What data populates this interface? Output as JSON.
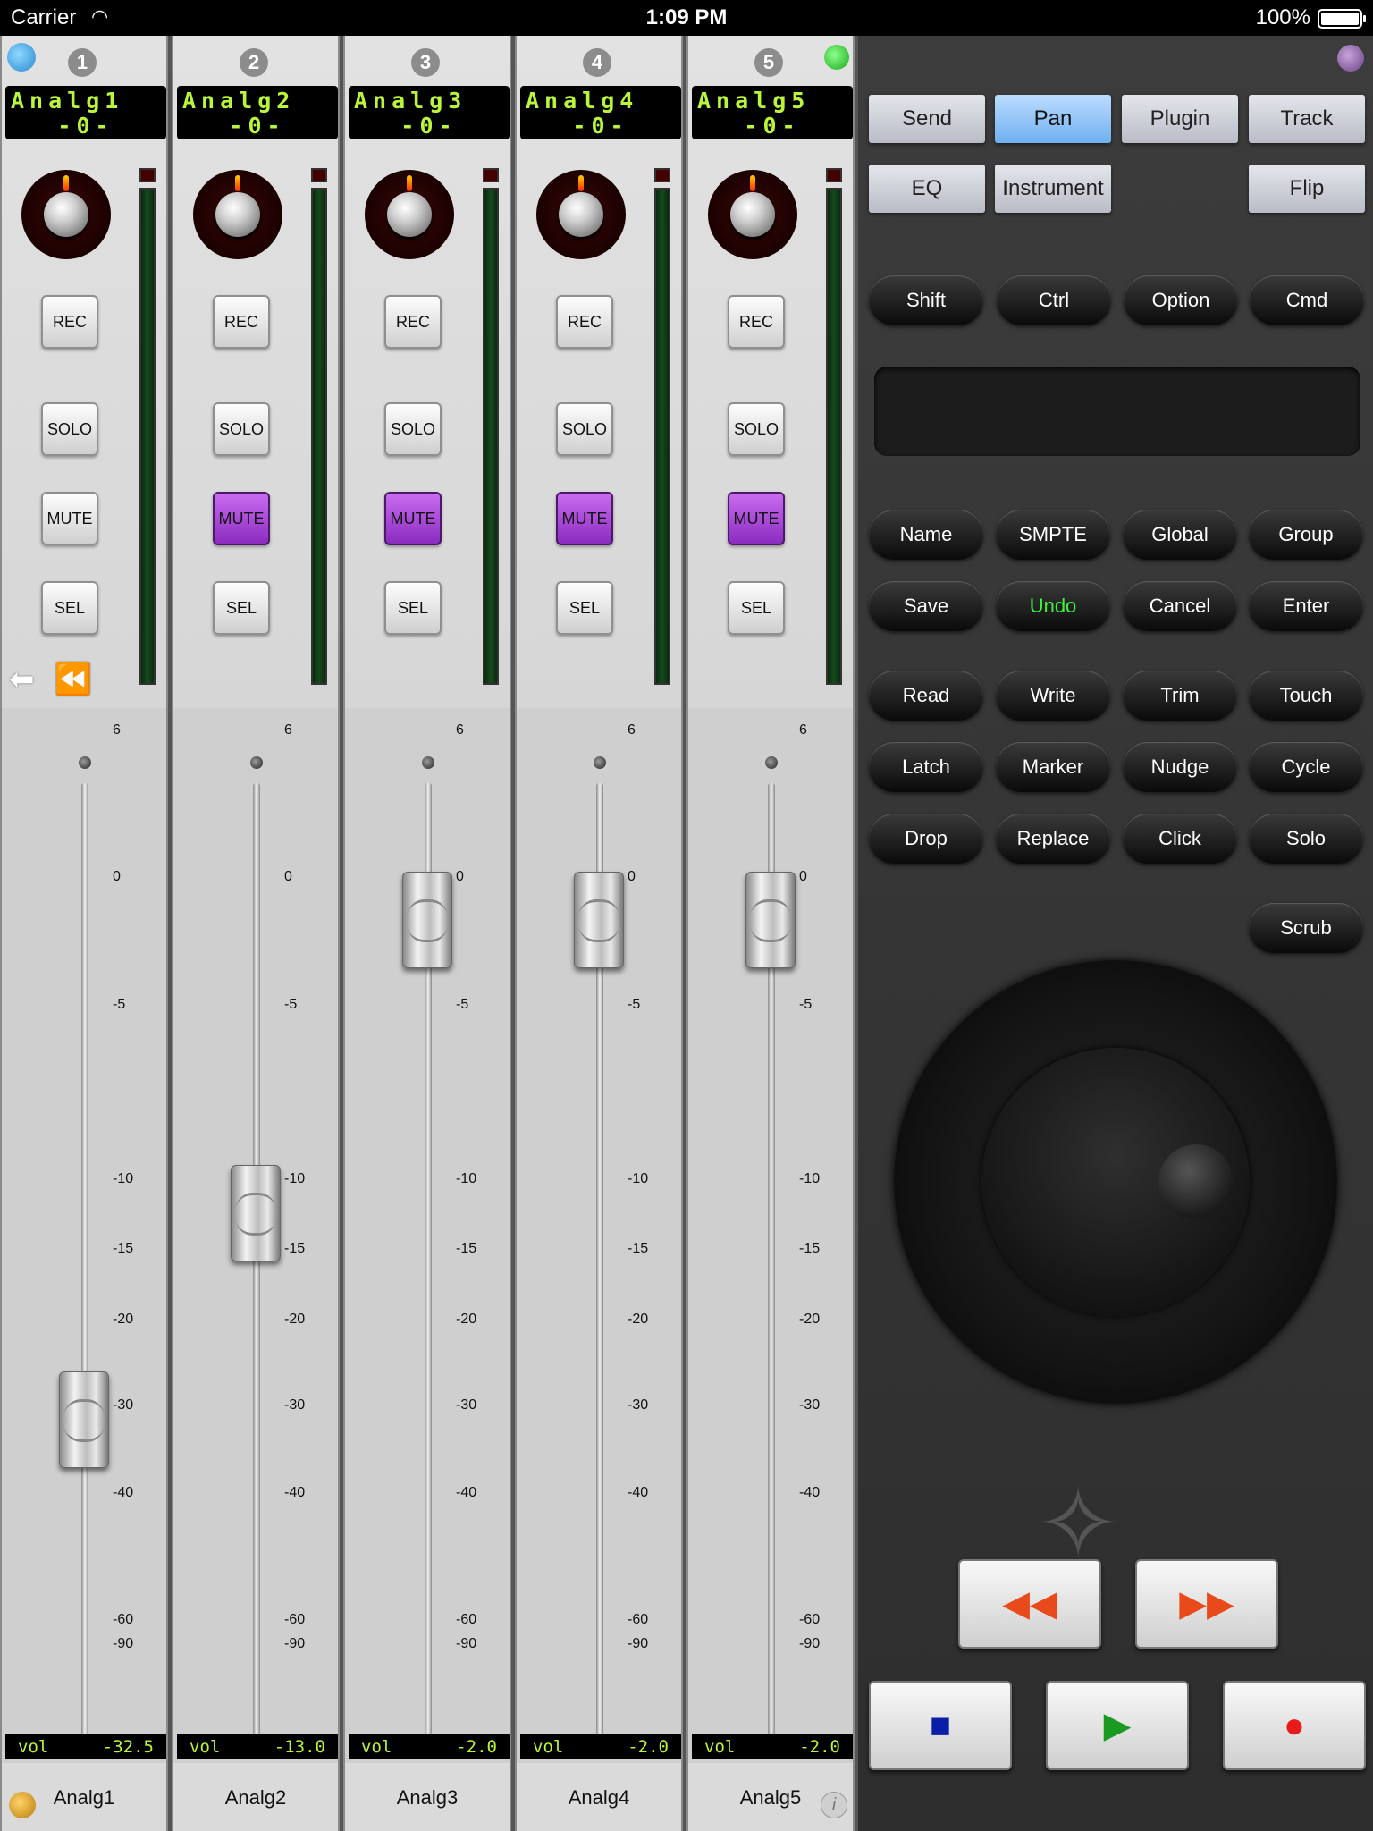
{
  "status": {
    "carrier": "Carrier",
    "time": "1:09 PM",
    "battery": "100%"
  },
  "strips": [
    {
      "num": "1",
      "lcd_name": "Analg1",
      "lcd_pan": "-0-",
      "vol_label": "vol",
      "vol_value": "-32.5",
      "name": "Analg1",
      "mute_on": false
    },
    {
      "num": "2",
      "lcd_name": "Analg2",
      "lcd_pan": "-0-",
      "vol_label": "vol",
      "vol_value": "-13.0",
      "name": "Analg2",
      "mute_on": true
    },
    {
      "num": "3",
      "lcd_name": "Analg3",
      "lcd_pan": "-0-",
      "vol_label": "vol",
      "vol_value": "-2.0",
      "name": "Analg3",
      "mute_on": true
    },
    {
      "num": "4",
      "lcd_name": "Analg4",
      "lcd_pan": "-0-",
      "vol_label": "vol",
      "vol_value": "-2.0",
      "name": "Analg4",
      "mute_on": true
    },
    {
      "num": "5",
      "lcd_name": "Analg5",
      "lcd_pan": "-0-",
      "vol_label": "vol",
      "vol_value": "-2.0",
      "name": "Analg5",
      "mute_on": true
    }
  ],
  "strip_buttons": {
    "rec": "REC",
    "solo": "SOLO",
    "mute": "MUTE",
    "sel": "SEL"
  },
  "scale": [
    "6",
    "0",
    "-5",
    "-10",
    "-15",
    "-20",
    "-30",
    "-40",
    "-60",
    "-90"
  ],
  "tabs": {
    "send": "Send",
    "pan": "Pan",
    "plugin": "Plugin",
    "track": "Track",
    "eq": "EQ",
    "instrument": "Instrument",
    "flip": "Flip"
  },
  "modifiers": {
    "shift": "Shift",
    "ctrl": "Ctrl",
    "option": "Option",
    "cmd": "Cmd"
  },
  "keys": {
    "name": "Name",
    "smpte": "SMPTE",
    "global": "Global",
    "group": "Group",
    "save": "Save",
    "undo": "Undo",
    "cancel": "Cancel",
    "enter": "Enter",
    "read": "Read",
    "write": "Write",
    "trim": "Trim",
    "touch": "Touch",
    "latch": "Latch",
    "marker": "Marker",
    "nudge": "Nudge",
    "cycle": "Cycle",
    "drop": "Drop",
    "replace": "Replace",
    "click": "Click",
    "solo": "Solo",
    "scrub": "Scrub"
  },
  "accent_colors": {
    "active_tab": "#6fb0f0",
    "mute_on": "#b04ee0",
    "lcd_text": "#b9f53a",
    "undo_text": "#3ef23e"
  }
}
